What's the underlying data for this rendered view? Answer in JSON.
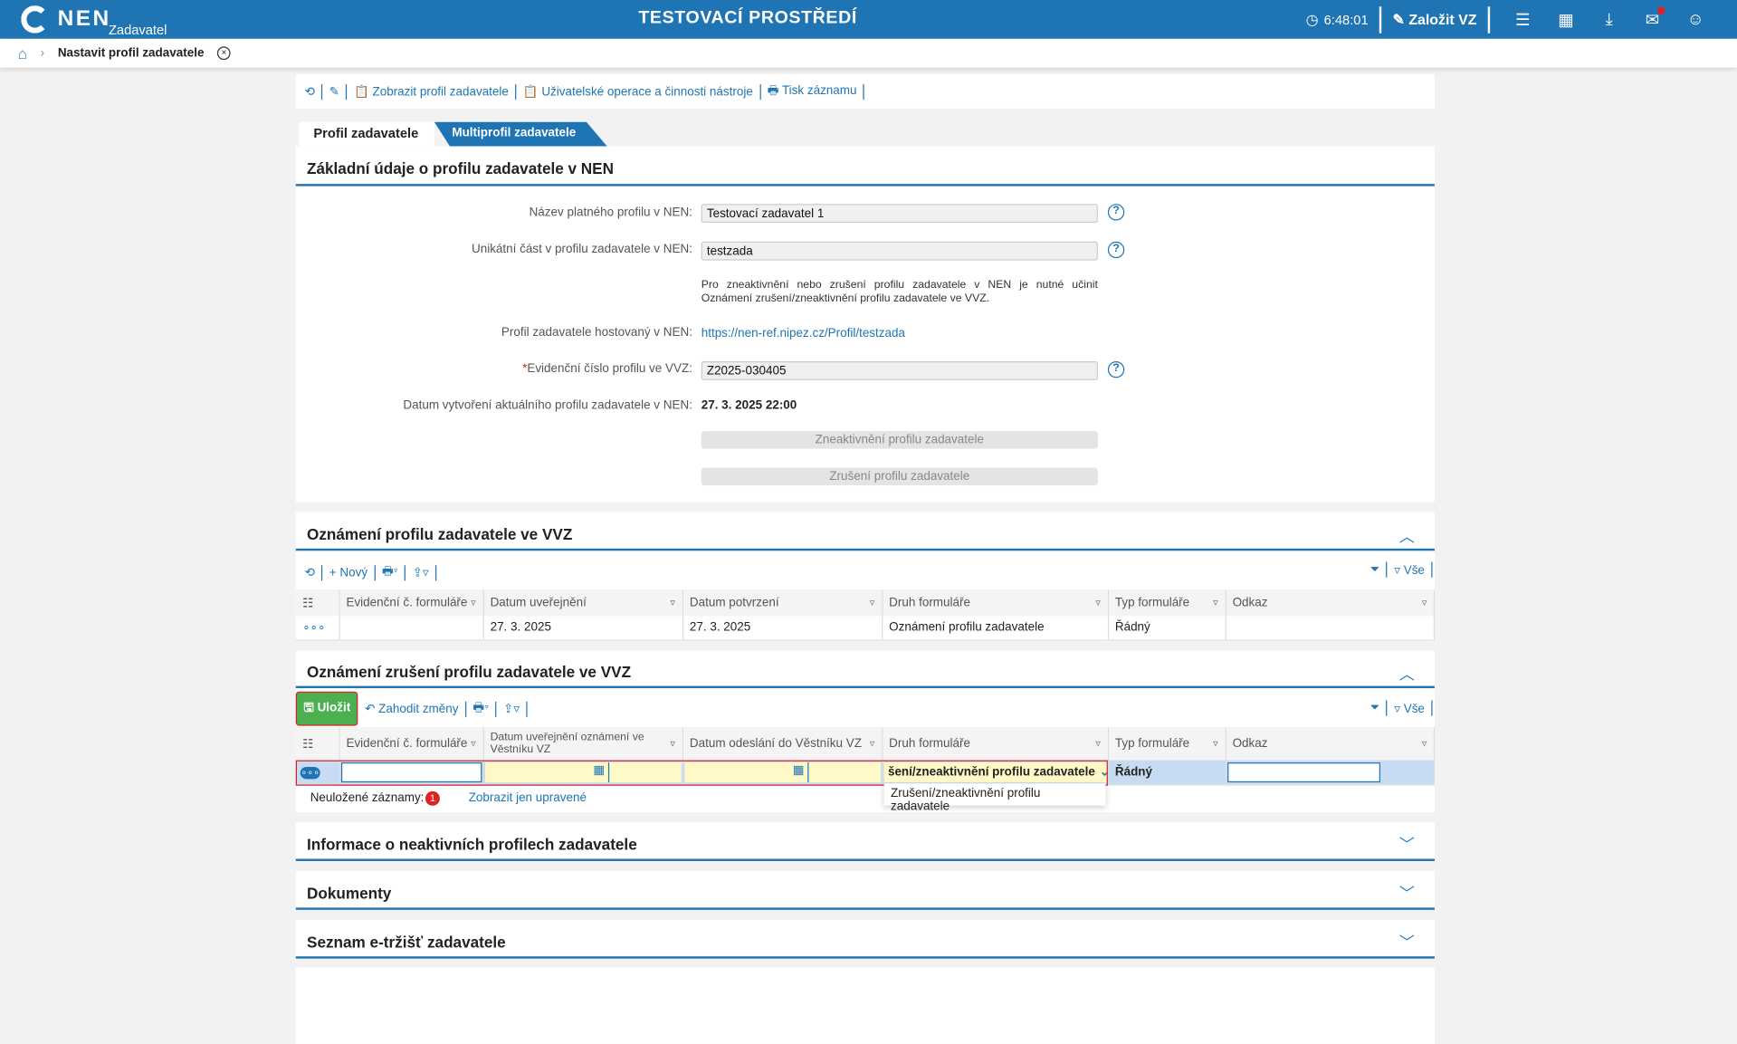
{
  "header": {
    "logo": "NEN",
    "logo_sub": "Zadavatel",
    "env_title": "TESTOVACÍ PROSTŘEDÍ",
    "time": "6:48:01",
    "create_label": "Založit VZ"
  },
  "breadcrumb": {
    "current": "Nastavit profil zadavatele"
  },
  "toolbar": {
    "show_profile": "Zobrazit profil zadavatele",
    "user_ops": "Uživatelské operace a činnosti nástroje",
    "print": "Tisk záznamu"
  },
  "tabs": [
    {
      "label": "Profil zadavatele"
    },
    {
      "label": "Multiprofil zadavatele"
    }
  ],
  "basic": {
    "title": "Základní údaje o profilu zadavatele v NEN",
    "name_label": "Název platného profilu v NEN:",
    "name_value": "Testovací zadavatel 1",
    "unique_label": "Unikátní část v profilu zadavatele v NEN:",
    "unique_value": "testzada",
    "note": "Pro zneaktivnění nebo zrušení profilu zadavatele v NEN je nutné učinit Oznámení zrušení/zneaktivnění profilu zadavatele ve VVZ.",
    "hosted_label": "Profil zadavatele hostovaný v NEN:",
    "hosted_url": "https://nen-ref.nipez.cz/Profil/testzada",
    "evid_label": "Evidenční číslo profilu ve VVZ:",
    "evid_value": "Z2025-030405",
    "date_label": "Datum vytvoření aktuálního profilu zadavatele v NEN:",
    "date_value": "27. 3. 2025 22:00",
    "deactivate_btn": "Zneaktivnění profilu zadavatele",
    "cancel_btn": "Zrušení profilu zadavatele"
  },
  "notice": {
    "title": "Oznámení profilu zadavatele ve VVZ",
    "new_label": "Nový",
    "all_label": "Vše",
    "columns": [
      "Evidenční č. formuláře",
      "Datum uveřejnění",
      "Datum potvrzení",
      "Druh formuláře",
      "Typ formuláře",
      "Odkaz"
    ],
    "rows": [
      [
        "",
        "27. 3. 2025",
        "27. 3. 2025",
        "Oznámení profilu zadavatele",
        "Řádný",
        ""
      ]
    ]
  },
  "cancel_notice": {
    "title": "Oznámení zrušení profilu zadavatele ve VVZ",
    "save_label": "Uložit",
    "discard_label": "Zahodit změny",
    "all_label": "Vše",
    "columns": [
      "Evidenční č. formuláře",
      "Datum uveřejnění oznámení ve Věstníku VZ",
      "Datum odeslání do Věstníku VZ",
      "Druh formuláře",
      "Typ formuláře",
      "Odkaz"
    ],
    "row": {
      "druh": "šení/zneaktivnění profilu zadavatele",
      "typ": "Řádný"
    },
    "dropdown_option": "Zrušení/zneaktivnění profilu zadavatele",
    "unsaved_label": "Neuložené záznamy:",
    "unsaved_count": "1",
    "show_modified": "Zobrazit jen upravené"
  },
  "sections": [
    {
      "title": "Informace o neaktivních profilech zadavatele"
    },
    {
      "title": "Dokumenty"
    },
    {
      "title": "Seznam e-tržišť zadavatele"
    }
  ]
}
